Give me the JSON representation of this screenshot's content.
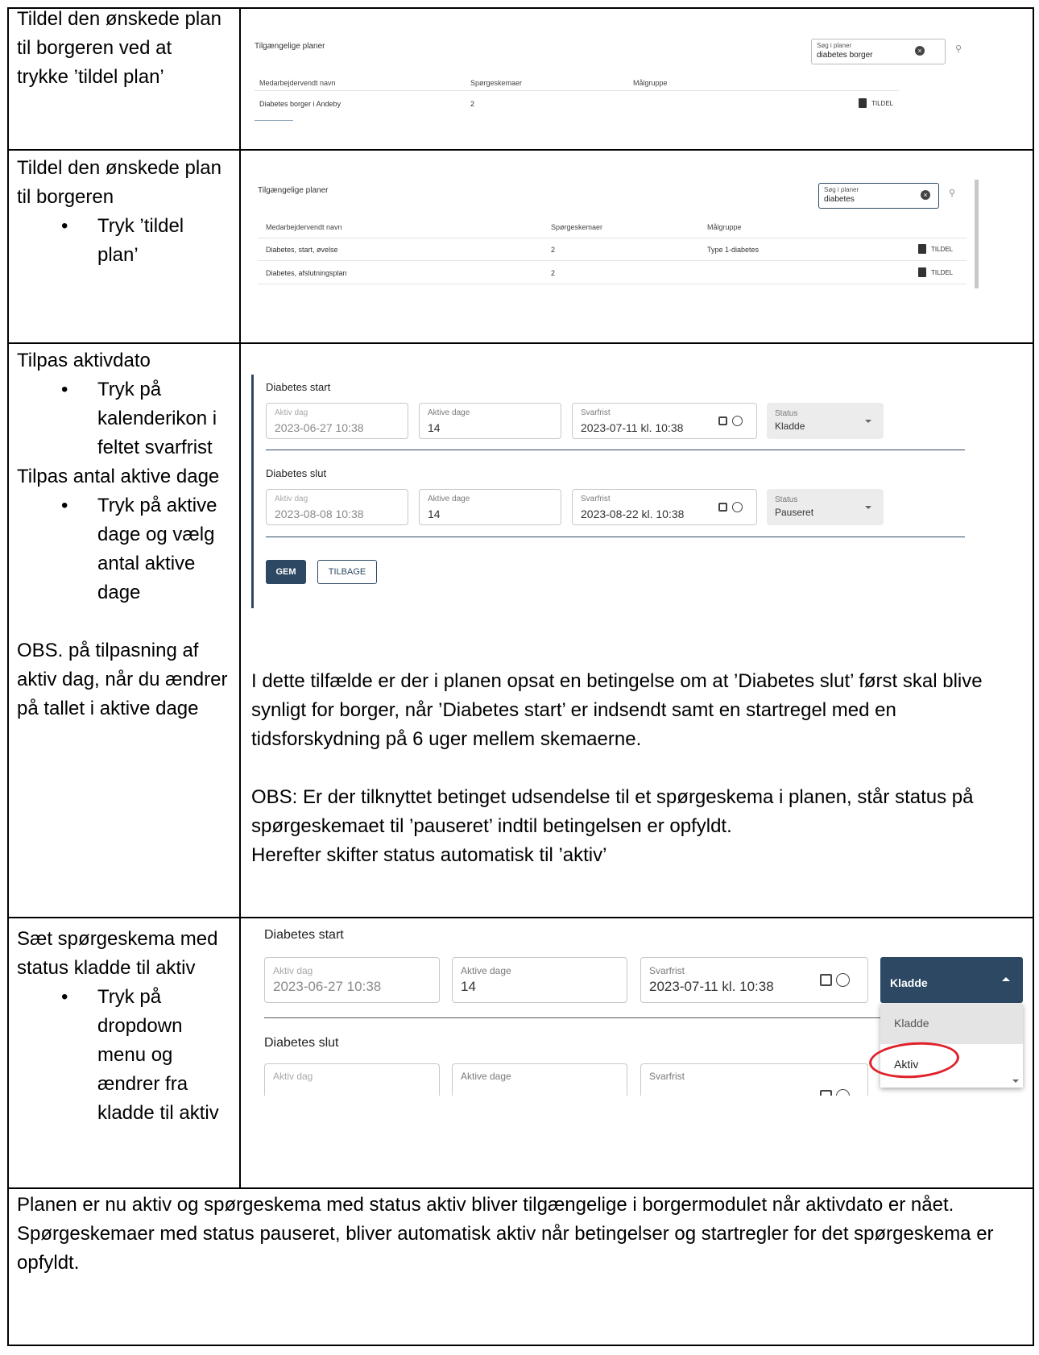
{
  "row1": {
    "instruction": "Tildel den ønskede plan til borgeren ved at trykke ’tildel plan’",
    "panel_title": "Tilgængelige planer",
    "search_label": "Søg i planer",
    "search_value": "diabetes borger",
    "columns": [
      "Medarbejdervendt navn",
      "Spørgeskemaer",
      "Målgruppe"
    ],
    "rows": [
      {
        "name": "Diabetes borger i Andeby",
        "count": "2",
        "group": "",
        "action": "TILDEL"
      }
    ]
  },
  "row2": {
    "instruction_line1": "Tildel den ønskede plan til borgeren",
    "bullet": "Tryk ’tildel plan’",
    "panel_title": "Tilgængelige planer",
    "search_label": "Søg i planer",
    "search_value": "diabetes",
    "columns": [
      "Medarbejdervendt navn",
      "Spørgeskemaer",
      "Målgruppe"
    ],
    "rows": [
      {
        "name": "Diabetes, start, øvelse",
        "count": "2",
        "group": "Type 1-diabetes",
        "action": "TILDEL"
      },
      {
        "name": "Diabetes, afslutningsplan",
        "count": "2",
        "group": "",
        "action": "TILDEL"
      }
    ]
  },
  "row3": {
    "heading1": "Tilpas aktivdato",
    "bullet1": "Tryk på kalenderikon i feltet svarfrist",
    "heading2": "Tilpas antal aktive dage",
    "bullet2": "Tryk på aktive dage og vælg antal aktive dage",
    "note": "OBS. på tilpasning af aktiv dag, når du ændrer på tallet i aktive dage",
    "forms": [
      {
        "title": "Diabetes start",
        "aktiv_dag_label": "Aktiv dag",
        "aktiv_dag": "2023-06-27 10:38",
        "aktive_dage_label": "Aktive dage",
        "aktive_dage": "14",
        "svarfrist_label": "Svarfrist",
        "svarfrist": "2023-07-11 kl. 10:38",
        "status_label": "Status",
        "status": "Kladde"
      },
      {
        "title": "Diabetes slut",
        "aktiv_dag_label": "Aktiv dag",
        "aktiv_dag": "2023-08-08 10:38",
        "aktive_dage_label": "Aktive dage",
        "aktive_dage": "14",
        "svarfrist_label": "Svarfrist",
        "svarfrist": "2023-08-22 kl. 10:38",
        "status_label": "Status",
        "status": "Pauseret"
      }
    ],
    "save_label": "GEM",
    "back_label": "TILBAGE",
    "explain1": "I dette tilfælde er der i planen opsat en betingelse om at ’Diabetes slut’ først skal blive synligt for borger, når ’Diabetes start’ er indsendt samt en startregel med en tidsforskydning på 6 uger mellem skemaerne.",
    "explain2": "OBS: Er der tilknyttet betinget udsendelse til et spørgeskema i planen, står status på spørgeskemaet til ’pauseret’ indtil betingelsen er opfyldt.",
    "explain3": "Herefter skifter status automatisk til ’aktiv’"
  },
  "row4": {
    "instruction": "Sæt spørgeskema med status kladde til aktiv",
    "bullet": "Tryk på dropdown menu og ændrer fra kladde til aktiv",
    "form1": {
      "title": "Diabetes start",
      "aktiv_dag_label": "Aktiv dag",
      "aktiv_dag": "2023-06-27 10:38",
      "aktive_dage_label": "Aktive dage",
      "aktive_dage": "14",
      "svarfrist_label": "Svarfrist",
      "svarfrist": "2023-07-11 kl. 10:38",
      "status": "Kladde"
    },
    "form2": {
      "title": "Diabetes slut",
      "aktiv_dag_label": "Aktiv dag",
      "aktive_dage_label": "Aktive dage",
      "svarfrist_label": "Svarfrist"
    },
    "dropdown_options": [
      "Kladde",
      "Aktiv"
    ]
  },
  "footer": {
    "line1": "Planen er nu aktiv og spørgeskema med status aktiv bliver tilgængelige i borgermodulet når aktivdato er nået.",
    "line2": "Spørgeskemaer med status pauseret, bliver automatisk aktiv når betingelser og startregler for det spørgeskema er opfyldt."
  },
  "colors": {
    "accent": "#2c4863",
    "highlight": "#e0202a"
  }
}
